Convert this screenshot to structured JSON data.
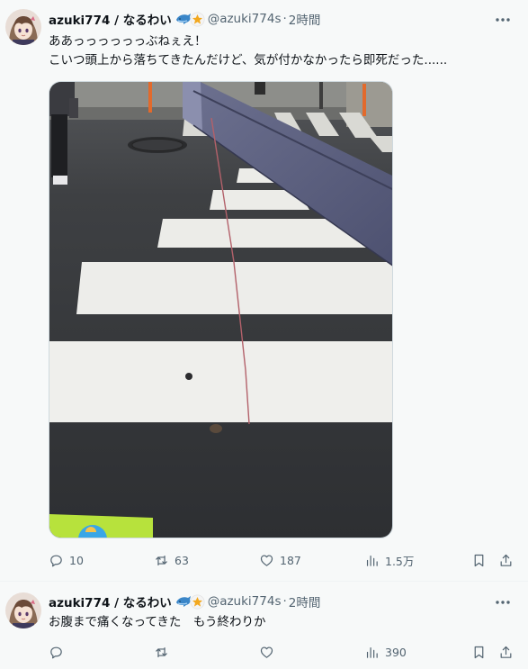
{
  "post1": {
    "display_name": "azuki774 / なるわい",
    "handle": "@azuki774s",
    "time": "2時間",
    "text_line1": "ああっっっっっっぶねぇえ！",
    "text_line2": "こいつ頭上から落ちてきたんだけど、気が付かなかったら即死だった......",
    "stats": {
      "replies": "10",
      "reposts": "63",
      "likes": "187",
      "views": "1.5万"
    }
  },
  "post2": {
    "display_name": "azuki774 / なるわい",
    "handle": "@azuki774s",
    "time": "2時間",
    "text": "お腹まで痛くなってきた　もう終わりか",
    "stats": {
      "views": "390"
    }
  },
  "icons": [
    "avatar",
    "dolphin-emoji-icon",
    "star-emoji-icon",
    "more-icon",
    "reply-icon",
    "repost-icon",
    "like-icon",
    "views-icon",
    "bookmark-icon",
    "share-icon"
  ],
  "colors": {
    "text": "#0f1419",
    "secondary": "#536471",
    "background": "#f7f9f9",
    "road": "#3b3d40",
    "crosswalk": "#eeeeea",
    "fallen_beam": "#5a5e7a"
  }
}
